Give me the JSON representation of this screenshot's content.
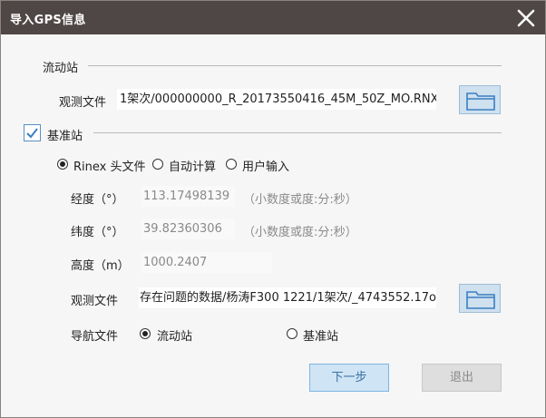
{
  "window": {
    "title": "导入GPS信息",
    "close_icon": "close-icon"
  },
  "rover": {
    "group_label": "流动站",
    "obs_label": "观测文件",
    "obs_value": "1架次/000000000_R_20173550416_45M_50Z_MO.RNX"
  },
  "base": {
    "checkbox_label": "基准站",
    "checked": true,
    "radio_options": [
      "Rinex 头文件",
      "自动计算",
      "用户输入"
    ],
    "selected_option": "Rinex 头文件",
    "longitude_label": "经度（°）",
    "longitude_value": "113.17498139",
    "longitude_hint": "（小数度或度:分:秒）",
    "latitude_label": "纬度（°）",
    "latitude_value": "39.82360306",
    "latitude_hint": "（小数度或度:分:秒）",
    "height_label": "高度（m）",
    "height_value": "1000.2407",
    "obs_label": "观测文件",
    "obs_value": "存在问题的数据/杨涛F300 1221/1架次/_4743552.17o",
    "nav_label": "导航文件",
    "nav_options": [
      "流动站",
      "基准站"
    ],
    "nav_selected": "流动站"
  },
  "buttons": {
    "next_label": "下一步",
    "exit_label": "退出"
  },
  "colors": {
    "titlebar": "#4f4745",
    "accent": "#5a8ec4",
    "folder": "#cfe0ef",
    "primary_button": "#cfe4f5"
  }
}
